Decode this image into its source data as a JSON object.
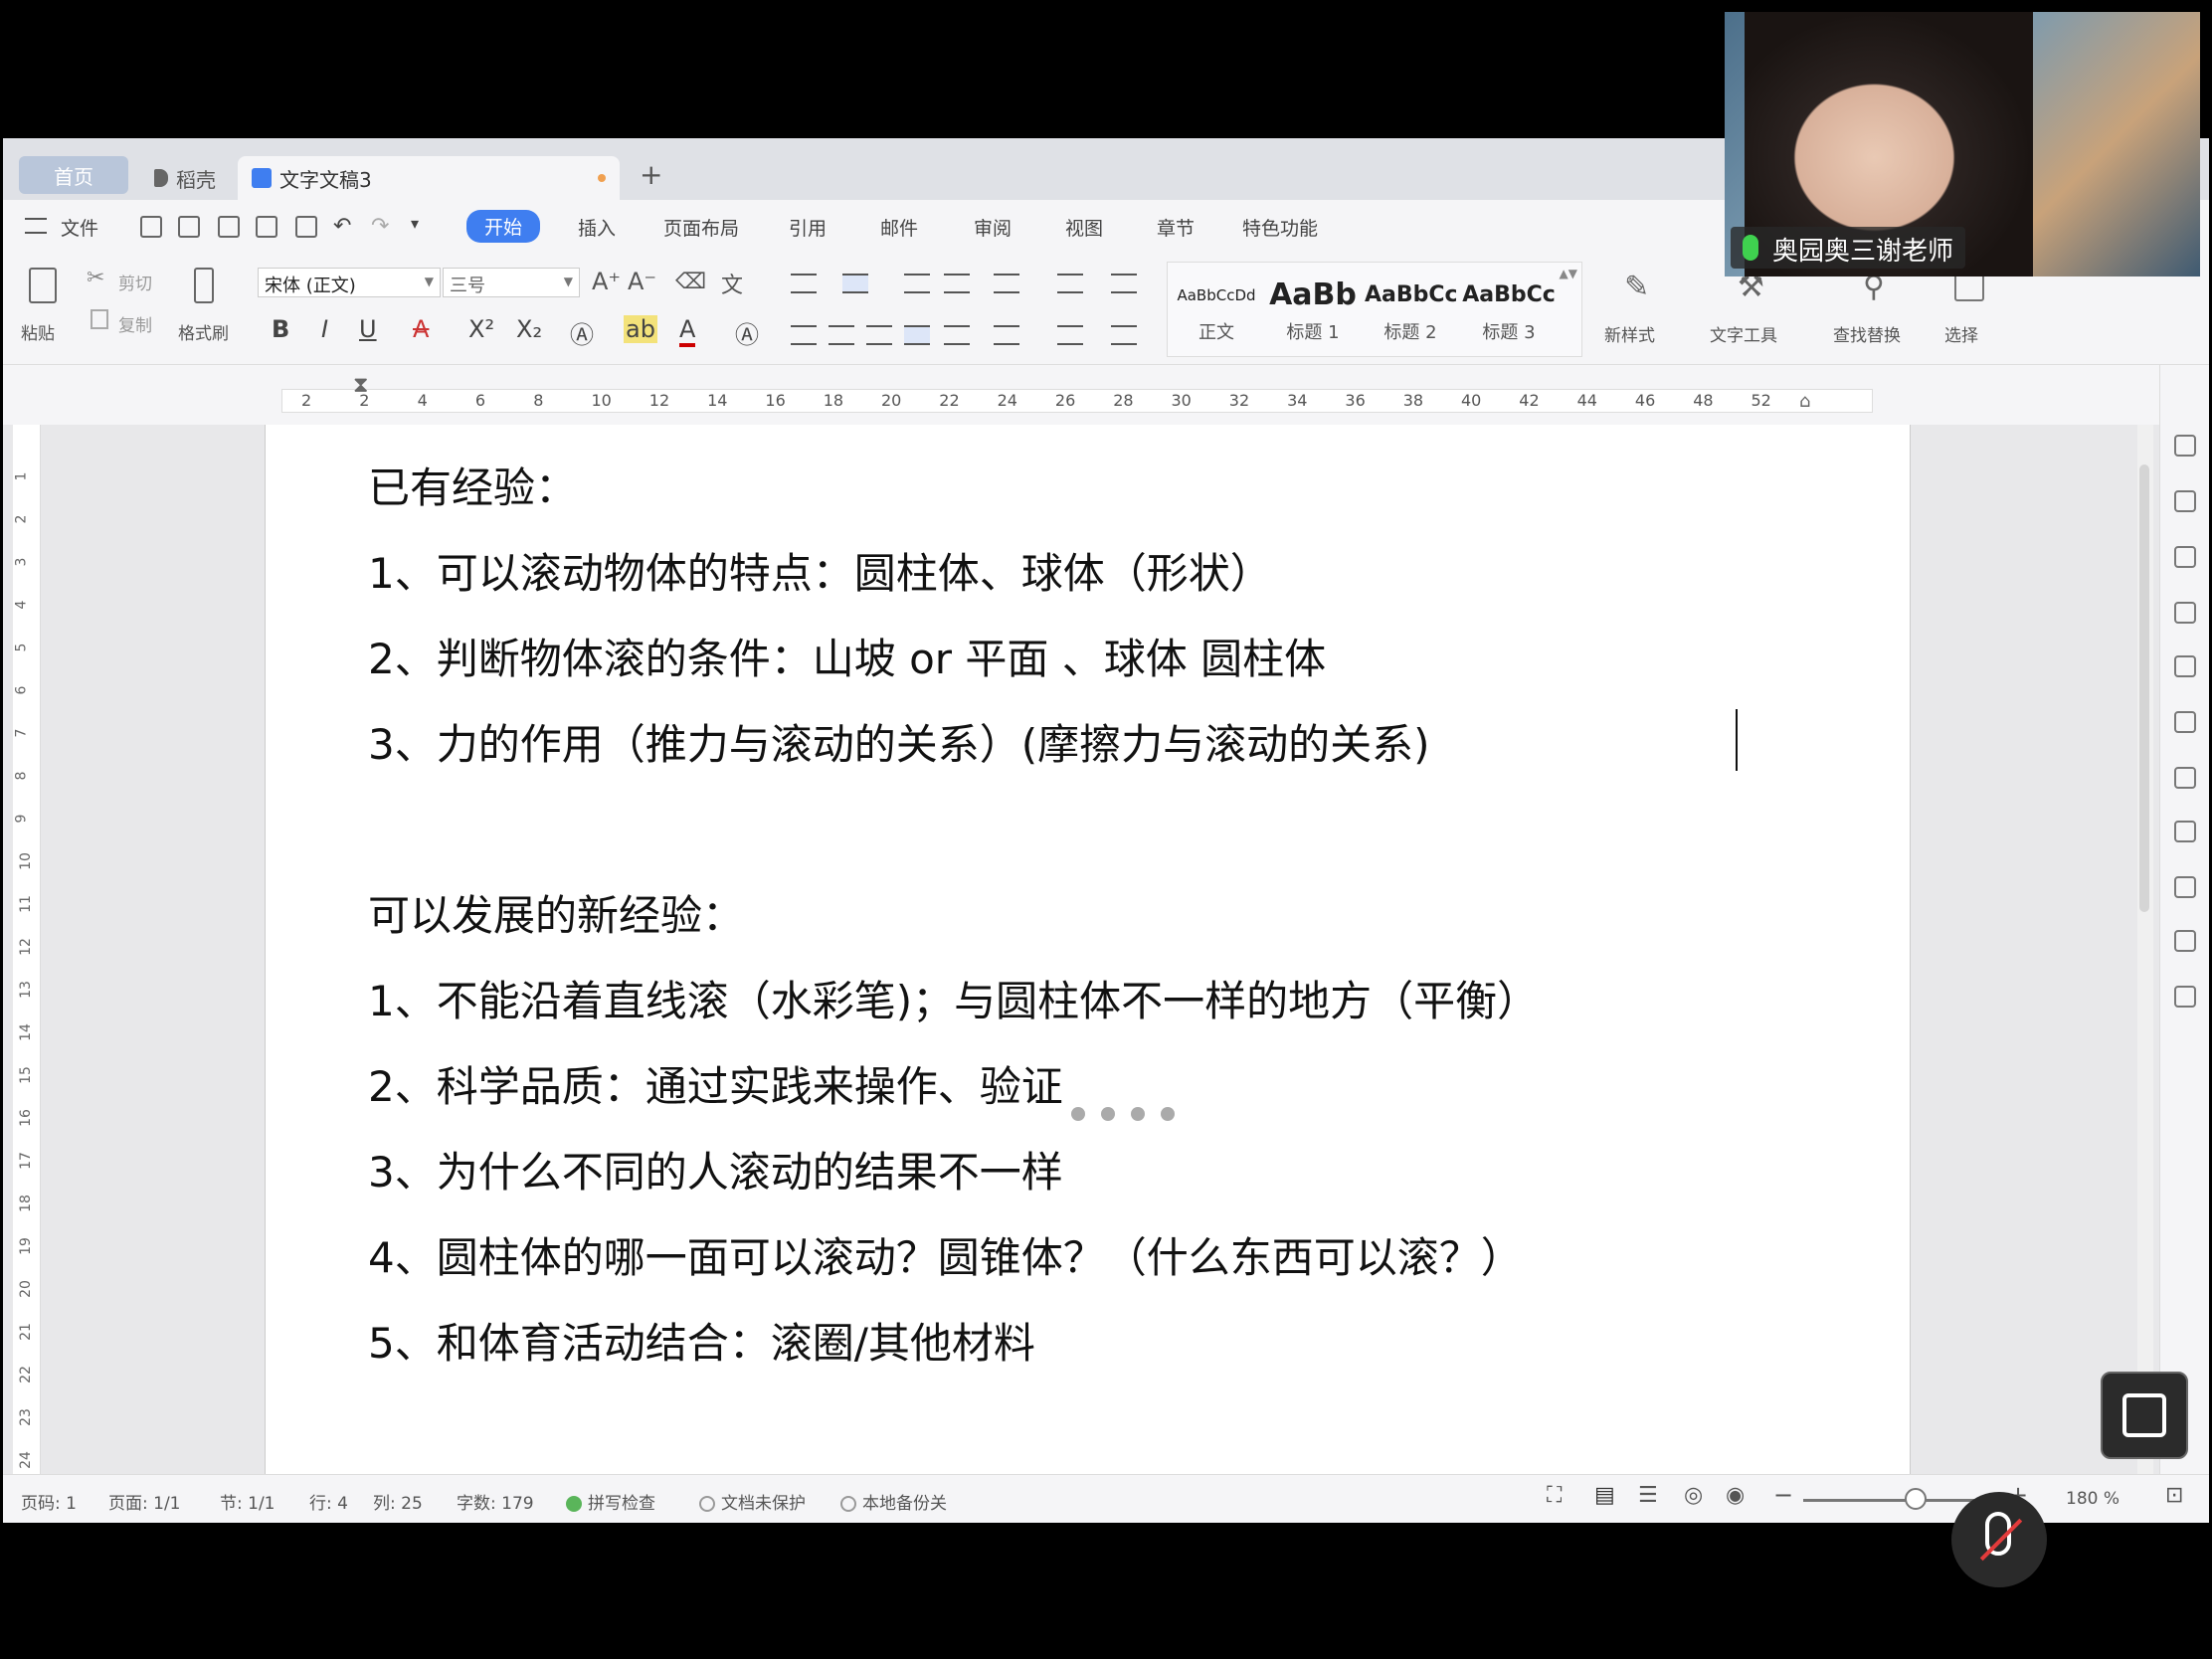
{
  "tabs": {
    "home": "首页",
    "shell": "稻壳",
    "doc": "文字文稿3",
    "add": "+"
  },
  "menu": {
    "file": "文件",
    "start": "开始",
    "insert": "插入",
    "layout": "页面布局",
    "reference": "引用",
    "mail": "邮件",
    "review": "审阅",
    "view": "视图",
    "chapter": "章节",
    "special": "特色功能"
  },
  "ribbon": {
    "paste": "粘贴",
    "cut": "剪切",
    "copy": "复制",
    "format_painter": "格式刷",
    "font_name": "宋体 (正文)",
    "font_size": "三号",
    "bold": "B",
    "italic": "I",
    "underline": "U",
    "styles": [
      {
        "sample": "AaBbCcDd",
        "label": "正文"
      },
      {
        "sample": "AaBb",
        "label": "标题 1"
      },
      {
        "sample": "AaBbCc",
        "label": "标题 2"
      },
      {
        "sample": "AaBbCc",
        "label": "标题 3"
      }
    ],
    "new_style": "新样式",
    "text_tools": "文字工具",
    "find_replace": "查找替换",
    "select": "选择"
  },
  "ruler": [
    "2",
    "2",
    "4",
    "6",
    "8",
    "10",
    "12",
    "14",
    "16",
    "18",
    "20",
    "22",
    "24",
    "26",
    "28",
    "30",
    "32",
    "34",
    "36",
    "38",
    "40",
    "42",
    "44",
    "46",
    "48",
    "52"
  ],
  "vruler": [
    "1",
    "2",
    "3",
    "4",
    "5",
    "6",
    "7",
    "8",
    "9",
    "10",
    "11",
    "12",
    "13",
    "14",
    "15",
    "16",
    "17",
    "18",
    "19",
    "20",
    "21",
    "22",
    "23",
    "24"
  ],
  "document": {
    "lines": [
      "已有经验：",
      "1、可以滚动物体的特点：圆柱体、球体（形状）",
      "2、判断物体滚的条件：山坡 or 平面 、球体 圆柱体",
      "3、力的作用（推力与滚动的关系）(摩擦力与滚动的关系)",
      "",
      "可以发展的新经验：",
      "1、不能沿着直线滚（水彩笔)；与圆柱体不一样的地方（平衡）",
      "2、科学品质：通过实践来操作、验证",
      "3、为什么不同的人滚动的结果不一样",
      "4、圆柱体的哪一面可以滚动？圆锥体？（什么东西可以滚？）",
      "5、和体育活动结合：滚圈/其他材料"
    ]
  },
  "status": {
    "page_code": "页码: 1",
    "page": "页面: 1/1",
    "section": "节: 1/1",
    "row": "行: 4",
    "col": "列: 25",
    "words": "字数: 179",
    "spell": "拼写检查",
    "protect": "文档未保护",
    "backup": "本地备份关",
    "zoom": "180 %"
  },
  "webcam": {
    "name": "奥园奥三谢老师"
  },
  "colors": {
    "accent": "#3f7ef0",
    "tab_home": "#b9c6da",
    "mic_green": "#3fd14f"
  }
}
